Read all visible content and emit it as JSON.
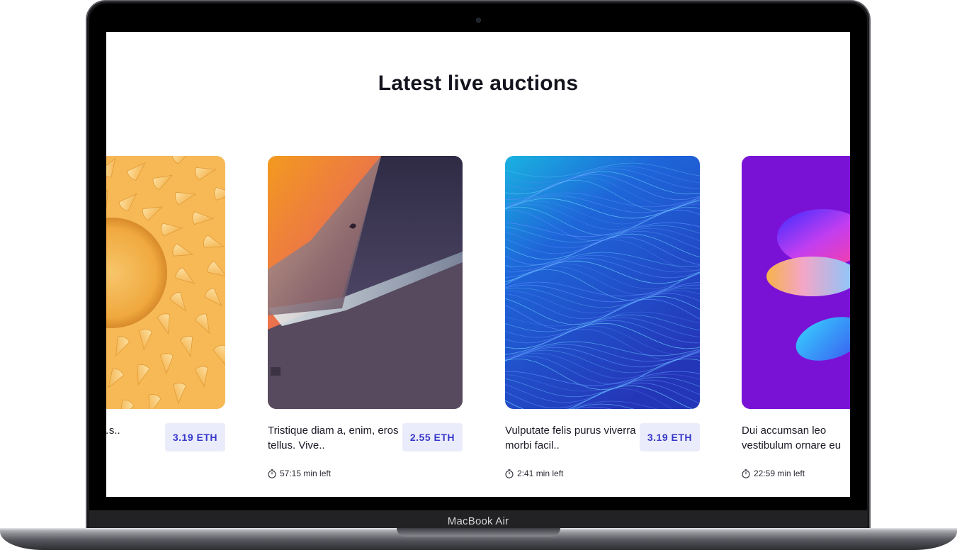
{
  "device": {
    "brand": "MacBook Air"
  },
  "page": {
    "heading": "Latest live auctions"
  },
  "auctions": [
    {
      "title": "…a lorem nisl …s..",
      "price": "3.19  ETH",
      "time_left": "",
      "art": "sunflower-art"
    },
    {
      "title": "Tristique diam a, enim, eros tellus. Vive..",
      "price": "2.55  ETH",
      "time_left": "57:15 min left",
      "art": "abstract-planes-art"
    },
    {
      "title": "Vulputate felis purus viverra morbi facil..",
      "price": "3.19  ETH",
      "time_left": "2:41 min left",
      "art": "blue-waves-art"
    },
    {
      "title": "Dui accumsan leo vestibulum ornare eu",
      "price": "",
      "time_left": "22:59 min left",
      "art": "purple-blob-art"
    }
  ],
  "icons": {
    "timer": "stopwatch-icon"
  },
  "colors": {
    "price_bg": "#ebecfb",
    "price_text": "#3537c9",
    "heading": "#14141f"
  }
}
